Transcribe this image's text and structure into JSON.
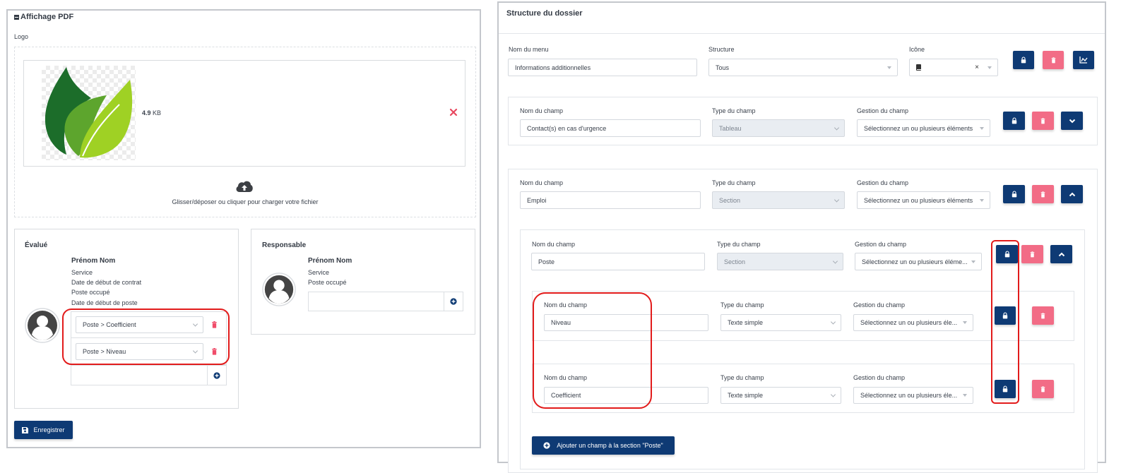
{
  "left": {
    "title": "Affichage PDF",
    "logo_label": "Logo",
    "file_size_value": "4.9",
    "file_size_unit": "KB",
    "upload_hint": "Glisser/déposer ou cliquer pour charger votre fichier",
    "evalue": {
      "title": "Évalué",
      "name": "Prénom Nom",
      "lines": [
        "Service",
        "Date de début de contrat",
        "Poste occupé",
        "Date de début de poste"
      ],
      "selects": [
        "Poste > Coefficient",
        "Poste > Niveau"
      ]
    },
    "responsable": {
      "title": "Responsable",
      "name": "Prénom Nom",
      "lines": [
        "Service",
        "Poste occupé"
      ]
    },
    "save_label": "Enregistrer"
  },
  "right": {
    "title": "Structure du dossier",
    "menu_row": {
      "menu_label": "Nom du menu",
      "menu_value": "Informations additionnelles",
      "structure_label": "Structure",
      "structure_value": "Tous",
      "icon_label": "Icône"
    },
    "labels": {
      "field_name": "Nom du champ",
      "field_type": "Type du champ",
      "field_mgmt": "Gestion du champ"
    },
    "fields": [
      {
        "name": "Contact(s) en cas d'urgence",
        "type": "Tableau",
        "mgmt": "Sélectionnez un ou plusieurs éléments"
      },
      {
        "name": "Emploi",
        "type": "Section",
        "mgmt": "Sélectionnez un ou plusieurs éléments"
      },
      {
        "name": "Poste",
        "type": "Section",
        "mgmt": "Sélectionnez un ou plusieurs éléme..."
      },
      {
        "name": "Niveau",
        "type": "Texte simple",
        "mgmt": "Sélectionnez un ou plusieurs éle..."
      },
      {
        "name": "Coefficient",
        "type": "Texte simple",
        "mgmt": "Sélectionnez un ou plusieurs éle..."
      }
    ],
    "add_field_label": "Ajouter un champ à la section \"Poste\""
  },
  "colors": {
    "navy": "#0e3a74",
    "pink": "#f26c86",
    "annotation_red": "#e21b1b",
    "delete_x": "#e8485f"
  },
  "icons": [
    "minus-square-icon",
    "leaf-logo",
    "close-icon",
    "cloud-upload-icon",
    "avatar-icon",
    "trash-icon",
    "plus-circle-icon",
    "save-icon",
    "lock-icon",
    "book-icon",
    "chart-icon",
    "chevron-down-icon",
    "chevron-up-icon"
  ]
}
